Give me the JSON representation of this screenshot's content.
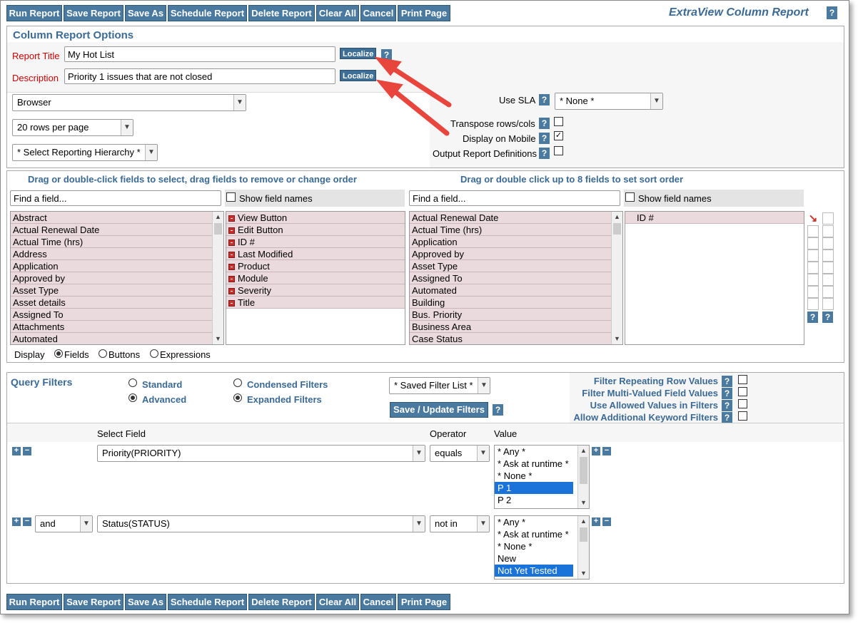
{
  "toolbar": {
    "buttons": [
      "Run Report",
      "Save Report",
      "Save As",
      "Schedule Report",
      "Delete Report",
      "Clear All",
      "Cancel",
      "Print Page"
    ],
    "title": "ExtraView Column Report",
    "help": "?"
  },
  "options": {
    "heading": "Column Report Options",
    "report_title_label": "Report Title",
    "report_title_value": "My Hot List",
    "description_label": "Description",
    "description_value": "Priority 1 issues that are not closed",
    "localize_label": "Localize",
    "output_select": "Browser",
    "rows_select": "20 rows per page",
    "hierarchy_select": "* Select Reporting Hierarchy *",
    "use_sla_label": "Use SLA",
    "sla_select": "* None *",
    "transpose_label": "Transpose rows/cols",
    "transpose_checked": false,
    "mobile_label": "Display on Mobile",
    "mobile_checked": true,
    "output_defs_label": "Output Report Definitions",
    "output_defs_checked": false
  },
  "fields": {
    "left_heading": "Drag or double-click fields to select, drag fields to remove or change order",
    "right_heading": "Drag or double click up to 8 fields to set sort order",
    "find_placeholder": "Find a field...",
    "show_names_label": "Show field names",
    "available_left": [
      "Abstract",
      "Actual Renewal Date",
      "Actual Time (hrs)",
      "Address",
      "Application",
      "Approved by",
      "Asset Type",
      "Asset details",
      "Assigned To",
      "Attachments",
      "Automated"
    ],
    "selected": [
      "View Button",
      "Edit Button",
      "ID #",
      "Last Modified",
      "Product",
      "Module",
      "Severity",
      "Title"
    ],
    "available_right": [
      "Actual Renewal Date",
      "Actual Time (hrs)",
      "Application",
      "Approved by",
      "Asset Type",
      "Assigned To",
      "Automated",
      "Building",
      "Bus. Priority",
      "Business Area",
      "Case Status"
    ],
    "sort_fields": [
      "ID #"
    ],
    "display_label": "Display",
    "display_options": [
      "Fields",
      "Buttons",
      "Expressions"
    ],
    "display_selected": "Fields"
  },
  "filters": {
    "heading": "Query Filters",
    "mode_standard": "Standard",
    "mode_advanced": "Advanced",
    "mode_selected": "Advanced",
    "condensed_label": "Condensed Filters",
    "expanded_label": "Expanded Filters",
    "view_selected": "Expanded Filters",
    "saved_list": "* Saved Filter List *",
    "save_update": "Save / Update Filters",
    "repeating_label": "Filter Repeating Row Values",
    "multi_label": "Filter Multi-Valued Field Values",
    "allowed_label": "Use Allowed Values in Filters",
    "keyword_label": "Allow Additional Keyword Filters",
    "col_select_field": "Select Field",
    "col_operator": "Operator",
    "col_value": "Value",
    "rows": [
      {
        "connector": "",
        "field": "Priority(PRIORITY)",
        "operator": "equals",
        "values": [
          "* Any *",
          "* Ask at runtime *",
          "* None *",
          "P 1",
          "P 2"
        ],
        "selected": "P 1"
      },
      {
        "connector": "and",
        "field": "Status(STATUS)",
        "operator": "not in",
        "values": [
          "* Any *",
          "* Ask at runtime *",
          "* None *",
          "New",
          "Not Yet Tested"
        ],
        "selected": "Not Yet Tested"
      }
    ]
  },
  "colors": {
    "accent": "#4a7aa0",
    "heading_blue": "#3b6a95",
    "label_red": "#cc0000",
    "annotation_arrow": "#e8453c",
    "list_row": "#eadadd"
  }
}
